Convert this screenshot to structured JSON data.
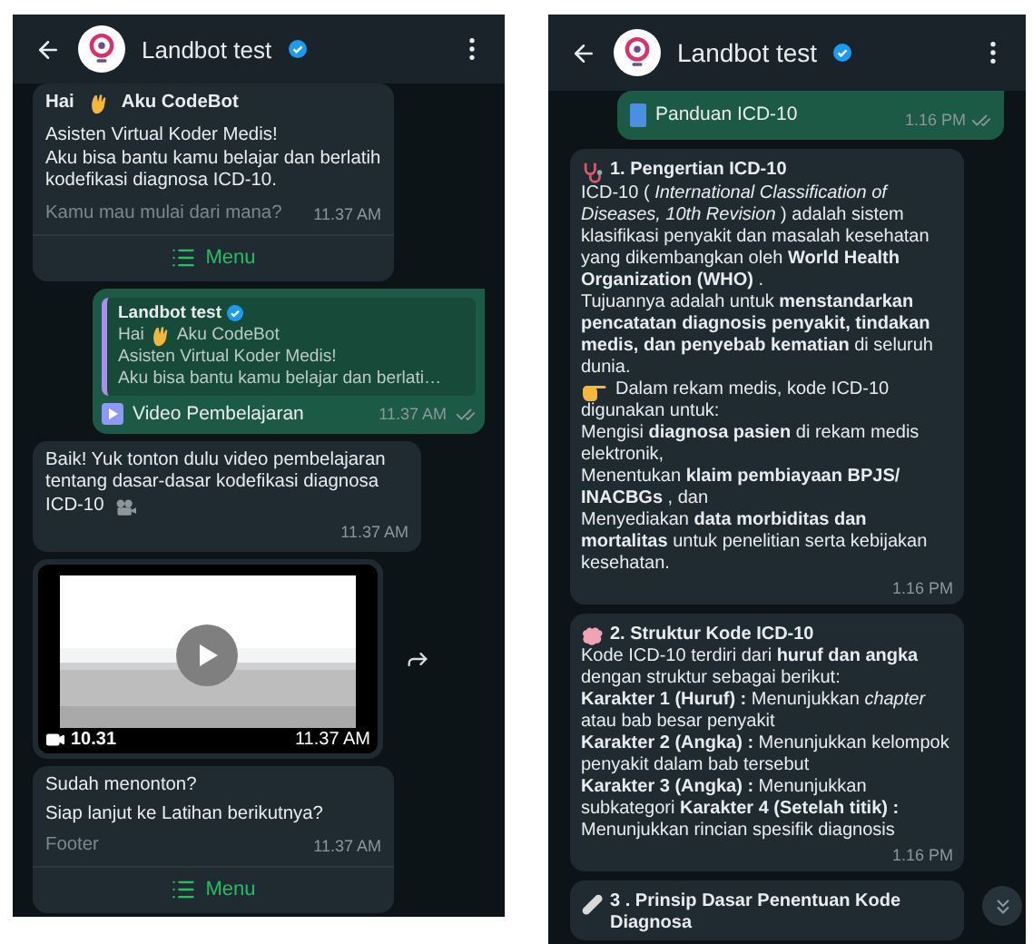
{
  "screens": [
    {
      "header": {
        "title": "Landbot test",
        "verified": true
      },
      "messages": [
        {
          "kind": "menu",
          "title": [
            {
              "text": "Hai"
            },
            {
              "kind": "icon"
            },
            {
              "text": "Aku CodeBot"
            }
          ],
          "lines": [
            [
              {
                "text": "Asisten Virtual Koder Medis!"
              }
            ],
            [
              {
                "text": "Aku bisa bantu kamu belajar dan berlatih kodefikasi diagnosa ICD-10."
              }
            ]
          ],
          "footer": "Kamu mau mulai dari mana?",
          "time": "11.37 AM",
          "button": "Menu"
        },
        {
          "kind": "reply",
          "quote": {
            "sender": "Landbot test",
            "verified": true,
            "lines": [
              [
                {
                  "text": "Hai"
                },
                {
                  "kind": "icon"
                },
                {
                  "text": "Aku CodeBot"
                }
              ],
              [
                {
                  "text": "Asisten Virtual Koder Medis!"
                }
              ],
              [
                {
                  "text": "Aku bisa bantu kamu belajar dan berlati…"
                }
              ]
            ]
          },
          "attachment": "Video Pembelajaran",
          "time": "11.37 AM",
          "read": false
        },
        {
          "kind": "text",
          "lines": [
            [
              {
                "text": "Baik! Yuk tonton dulu video pembelajaran tentang dasar-dasar kodefikasi diagnosa"
              }
            ],
            [
              {
                "text": "ICD-10"
              },
              {
                "kind": "icon"
              }
            ]
          ],
          "time": "11.37 AM"
        },
        {
          "kind": "video",
          "duration": "10.31",
          "time": "11.37 AM"
        },
        {
          "kind": "menu",
          "lines": [
            [
              {
                "text": "Sudah menonton?"
              }
            ],
            [
              {
                "text": "Siap lanjut ke Latihan berikutnya?"
              }
            ]
          ],
          "footer": "Footer",
          "time": "11.37 AM",
          "button": "Menu"
        }
      ]
    },
    {
      "header": {
        "title": "Landbot test",
        "verified": true
      },
      "scroll_down_button": true,
      "messages": [
        {
          "kind": "document",
          "name": "Panduan ICD-10",
          "time": "1.16 PM",
          "read": false
        },
        {
          "kind": "article",
          "title": [
            {
              "kind": "icon"
            },
            {
              "text": "1. Pengertian ICD-10"
            }
          ],
          "lines": [
            [
              {
                "text": "ICD-10 ( *International Classification of Diseases, 10th Revision* ) adalah sistem klasifikasi penyakit dan masalah kesehatan yang dikembangkan oleh **World Health Organization (WHO)** ."
              }
            ],
            [
              {
                "text": "Tujuannya adalah untuk **menstandarkan pencatatan diagnosis penyakit, tindakan medis, dan penyebab kematian** di seluruh dunia."
              }
            ],
            [
              {
                "kind": "icon"
              },
              {
                "text": "Dalam rekam medis, kode ICD-10"
              }
            ],
            [
              {
                "text": "digunakan untuk:"
              }
            ],
            [
              {
                "text": "Mengisi **diagnosa pasien** di rekam medis elektronik,"
              }
            ],
            [
              {
                "text": "Menentukan **klaim pembiayaan BPJS/ INACBGs** , dan"
              }
            ],
            [
              {
                "text": "Menyediakan **data morbiditas dan mortalitas** untuk penelitian serta kebijakan kesehatan."
              }
            ]
          ],
          "time": "1.16 PM"
        },
        {
          "kind": "article",
          "title": [
            {
              "kind": "icon"
            },
            {
              "text": "2. Struktur Kode ICD-10"
            }
          ],
          "lines": [
            [
              {
                "text": "Kode ICD-10 terdiri dari **huruf dan angka** dengan struktur sebagai berikut:"
              }
            ],
            [
              {
                "text": "**Karakter 1 (Huruf) :** Menunjukkan *chapter* atau bab besar penyakit"
              }
            ],
            [
              {
                "text": "**Karakter 2 (Angka) :** Menunjukkan kelompok penyakit dalam bab tersebut"
              }
            ],
            [
              {
                "text": "**Karakter 3 (Angka) :** Menunjukkan subkategori **Karakter 4 (Setelah titik) :** Menunjukkan rincian spesifik diagnosis"
              }
            ]
          ],
          "time": "1.16 PM"
        },
        {
          "kind": "article",
          "title": [
            {
              "kind": "icon"
            },
            {
              "text": "3 . Prinsip Dasar Penentuan Kode Diagnosa"
            }
          ]
        }
      ]
    }
  ]
}
